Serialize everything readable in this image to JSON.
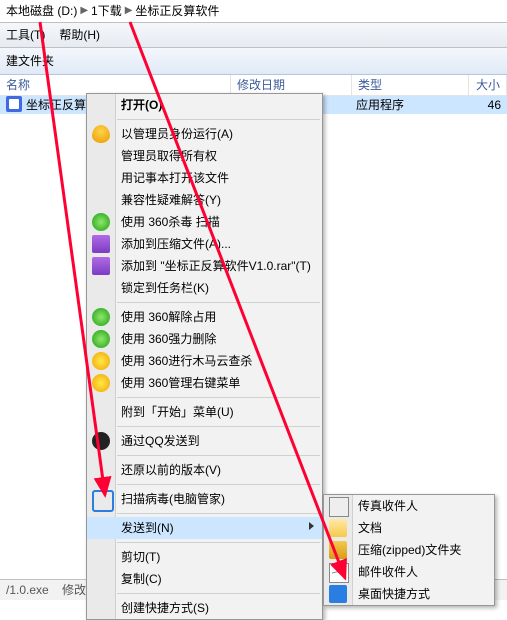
{
  "breadcrumb": {
    "a": "本地磁盘 (D:)",
    "b": "1下载",
    "c": "坐标正反算软件"
  },
  "menubar": {
    "tools": "工具(T)",
    "help": "帮助(H)"
  },
  "toolbar": {
    "new_folder": "建文件夹"
  },
  "columns": {
    "name": "名称",
    "date": "修改日期",
    "type": "类型",
    "size": "大小"
  },
  "file": {
    "name": "坐标正反算",
    "type": "应用程序",
    "size": "46"
  },
  "status": {
    "file": "/1.0.exe",
    "mod": "修改E"
  },
  "ctx": [
    {
      "t": "打开(O)",
      "b": true
    },
    {
      "sep": 1
    },
    {
      "ic": "ic-shield",
      "t": "以管理员身份运行(A)"
    },
    {
      "t": "管理员取得所有权"
    },
    {
      "t": "用记事本打开该文件"
    },
    {
      "t": "兼容性疑难解答(Y)"
    },
    {
      "ic": "ic-360",
      "t": "使用 360杀毒 扫描"
    },
    {
      "ic": "ic-rar",
      "t": "添加到压缩文件(A)..."
    },
    {
      "ic": "ic-rar",
      "t": "添加到 \"坐标正反算软件V1.0.rar\"(T)"
    },
    {
      "t": "锁定到任务栏(K)"
    },
    {
      "sep": 1
    },
    {
      "ic": "ic-360",
      "t": "使用 360解除占用"
    },
    {
      "ic": "ic-360",
      "t": "使用 360强力删除"
    },
    {
      "ic": "ic-yell",
      "t": "使用 360进行木马云查杀"
    },
    {
      "ic": "ic-yell",
      "t": "使用 360管理右键菜单"
    },
    {
      "sep": 1
    },
    {
      "t": "附到「开始」菜单(U)"
    },
    {
      "sep": 1
    },
    {
      "ic": "ic-qq",
      "t": "通过QQ发送到"
    },
    {
      "sep": 1
    },
    {
      "t": "还原以前的版本(V)"
    },
    {
      "sep": 1
    },
    {
      "ic": "ic-tencent",
      "t": "扫描病毒(电脑管家)"
    },
    {
      "sep": 1
    },
    {
      "t": "发送到(N)",
      "sub": true,
      "hi": true
    },
    {
      "sep": 1
    },
    {
      "t": "剪切(T)"
    },
    {
      "t": "复制(C)"
    },
    {
      "sep": 1
    },
    {
      "t": "创建快捷方式(S)"
    }
  ],
  "sub": [
    {
      "ic": "ic-fax",
      "t": "传真收件人"
    },
    {
      "ic": "ic-doc",
      "t": "文档"
    },
    {
      "ic": "ic-zip",
      "t": "压缩(zipped)文件夹"
    },
    {
      "ic": "ic-mail",
      "t": "邮件收件人"
    },
    {
      "ic": "ic-desk",
      "t": "桌面快捷方式"
    }
  ]
}
